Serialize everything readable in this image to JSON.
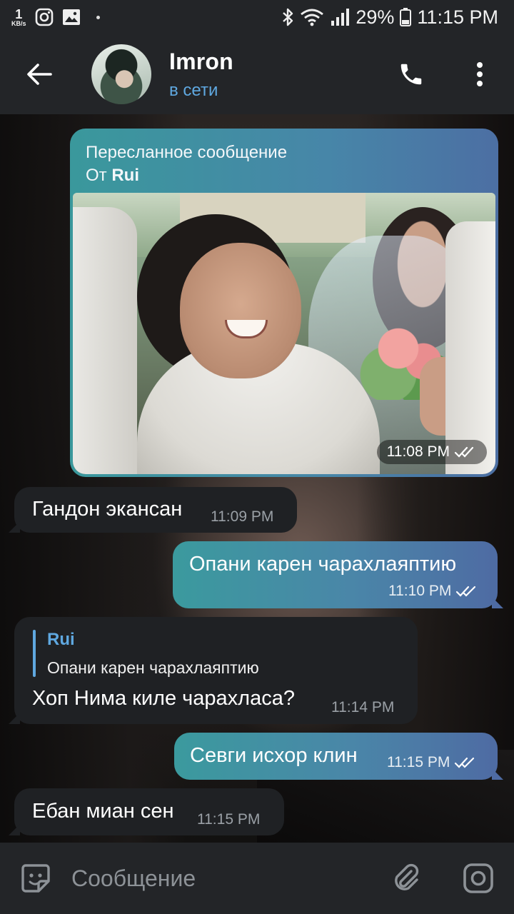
{
  "status_bar": {
    "net_speed_value": "1",
    "net_speed_unit": "KB/s",
    "battery": "29%",
    "time": "11:15 PM"
  },
  "header": {
    "contact_name": "Imron",
    "contact_status": "в сети"
  },
  "messages": {
    "forwarded": {
      "label": "Пересланное сообщение",
      "from_prefix": "От",
      "from_name": "Rui",
      "time": "11:08 PM"
    },
    "m1": {
      "text": "Гандон экансан",
      "time": "11:09 PM"
    },
    "m2": {
      "text": "Опани карен чарахлаяптию",
      "time": "11:10 PM"
    },
    "m3": {
      "reply_name": "Rui",
      "reply_text": "Опани карен чарахлаяптию",
      "text": "Хоп Нима киле чарахласа?",
      "time": "11:14 PM"
    },
    "m4": {
      "text": "Севги исхор клин",
      "time": "11:15 PM"
    },
    "m5": {
      "text": "Ебан миан сен",
      "time": "11:15 PM"
    }
  },
  "input": {
    "placeholder": "Сообщение"
  },
  "colors": {
    "accent": "#5fa8e0",
    "bar": "#232528",
    "incoming_bubble": "#1f2124",
    "outgoing_start": "#3b9a9e",
    "outgoing_end": "#4e6ba3"
  },
  "icons": [
    "instagram-icon",
    "gallery-icon",
    "bluetooth-icon",
    "wifi-icon",
    "signal-icon",
    "battery-icon",
    "back-arrow-icon",
    "phone-icon",
    "more-vert-icon",
    "sticker-icon",
    "attach-icon",
    "camera-icon",
    "double-check-icon"
  ]
}
